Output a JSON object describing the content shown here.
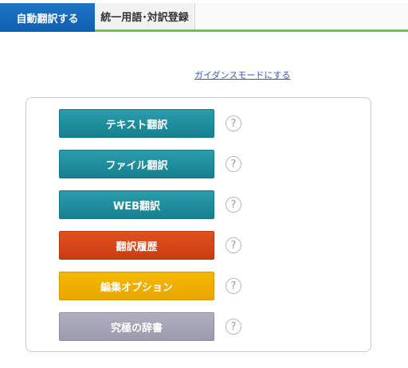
{
  "tabs": [
    {
      "label": "自動翻訳する",
      "active": true
    },
    {
      "label": "統一用語･対訳登録",
      "active": false
    }
  ],
  "guidance_link": "ガイダンスモードにする",
  "menu": [
    {
      "label": "テキスト翻訳",
      "color": "#1c8a99",
      "help": "?"
    },
    {
      "label": "ファイル翻訳",
      "color": "#1c8a99",
      "help": "?"
    },
    {
      "label": "WEB翻訳",
      "color": "#1c8a99",
      "help": "?"
    },
    {
      "label": "翻訳履歴",
      "color": "#d44614",
      "help": "?"
    },
    {
      "label": "編集オプション",
      "color": "#f0ae00",
      "help": "?"
    },
    {
      "label": "究極の辞書",
      "color": "#a6a4b8",
      "help": "?"
    }
  ],
  "colors": {
    "tab_active": "#1569bb",
    "tab_underline": "#6ec244",
    "link": "#3355cc"
  }
}
